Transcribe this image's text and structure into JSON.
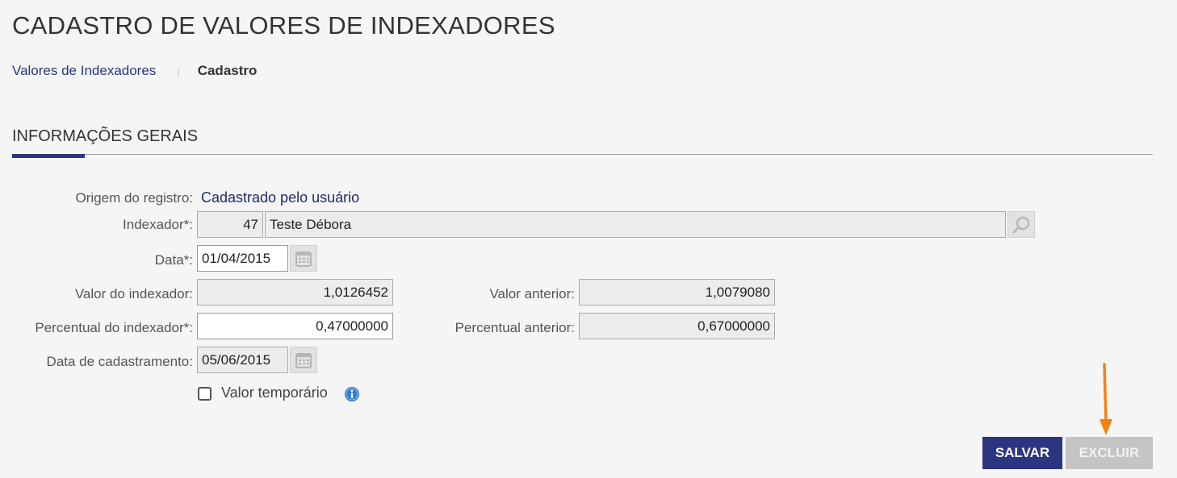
{
  "page": {
    "title": "CADASTRO DE VALORES DE INDEXADORES"
  },
  "breadcrumb": {
    "link": "Valores de Indexadores",
    "separator": "|",
    "current": "Cadastro"
  },
  "section": {
    "title": "INFORMAÇÕES GERAIS"
  },
  "form": {
    "origem": {
      "label": "Origem do registro:",
      "value": "Cadastrado pelo usuário"
    },
    "indexador": {
      "label": "Indexador*:",
      "code": "47",
      "name": "Teste Débora"
    },
    "data": {
      "label": "Data*:",
      "value": "01/04/2015"
    },
    "valor_indexador": {
      "label": "Valor do indexador:",
      "value": "1,0126452"
    },
    "valor_anterior": {
      "label": "Valor anterior:",
      "value": "1,0079080"
    },
    "percentual_indexador": {
      "label": "Percentual do indexador*:",
      "value": "0,47000000"
    },
    "percentual_anterior": {
      "label": "Percentual anterior:",
      "value": "0,67000000"
    },
    "data_cadastramento": {
      "label": "Data de cadastramento:",
      "value": "05/06/2015"
    },
    "valor_temporario": {
      "label": "Valor temporário",
      "checked": false
    }
  },
  "actions": {
    "save_label": "SALVAR",
    "delete_label": "EXCLUIR"
  },
  "colors": {
    "primary": "#2c3580",
    "disabled_button": "#c4c4c4",
    "annotation_arrow": "#f5820f",
    "info_icon": "#2f7bd3"
  },
  "icons": {
    "lookup": "magnifier-icon",
    "calendar": "calendar-icon",
    "info": "info-icon",
    "annotation": "arrow-down-icon"
  }
}
